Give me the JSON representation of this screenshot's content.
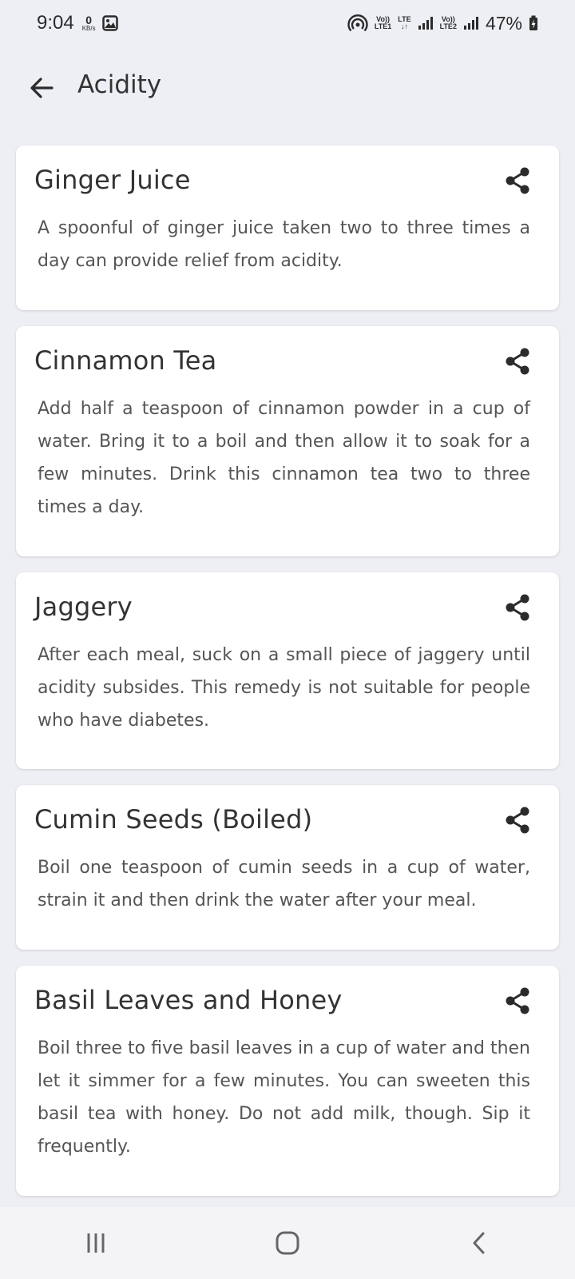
{
  "status_bar": {
    "time": "9:04",
    "speed_value": "0",
    "speed_unit": "KB/s",
    "sim1_line1": "Vo))",
    "sim1_line2": "LTE1",
    "lte_top": "LTE",
    "lte_bottom": "↓↑",
    "sim2_line1": "Vo))",
    "sim2_line2": "LTE2",
    "battery": "47%"
  },
  "header": {
    "title": "Acidity"
  },
  "remedies": [
    {
      "title": "Ginger Juice",
      "description": "A spoonful of ginger juice taken two to three times a day can provide relief from acidity."
    },
    {
      "title": "Cinnamon Tea",
      "description": "Add half a teaspoon of cinnamon powder in a cup of water. Bring it to a boil and then allow it to soak for a few minutes. Drink this cinnamon tea two to three times a day."
    },
    {
      "title": "Jaggery",
      "description": "After each meal, suck on a small piece of jaggery until acidity subsides. This remedy is not suitable for people who have diabetes."
    },
    {
      "title": "Cumin Seeds (Boiled)",
      "description": "Boil one teaspoon of cumin seeds in a cup of water, strain it and then drink the water after your meal."
    },
    {
      "title": "Basil Leaves and Honey",
      "description": "Boil three to five basil leaves in a cup of water and then let it simmer for a few minutes. You can sweeten this basil tea with honey. Do not add milk, though. Sip it frequently."
    }
  ],
  "icons": {
    "back": "arrow-left-icon",
    "share": "share-icon",
    "recents": "recents-icon",
    "home": "home-icon",
    "nav_back": "chevron-left-icon"
  },
  "colors": {
    "background": "#eeeff4",
    "card": "#ffffff",
    "title_text": "#333333",
    "body_text": "#555555"
  }
}
